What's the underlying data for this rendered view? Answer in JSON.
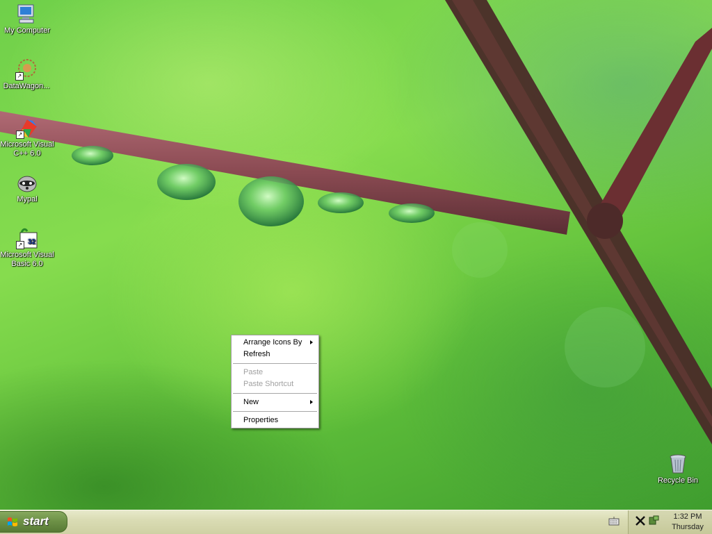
{
  "desktop": {
    "icons": [
      {
        "label": "My Computer"
      },
      {
        "label": "DataWagon..."
      },
      {
        "label": "Microsoft Visual C++ 6.0"
      },
      {
        "label": "Mypal"
      },
      {
        "label": "Microsoft Visual Basic 6.0"
      },
      {
        "label": "Recycle Bin"
      }
    ]
  },
  "context_menu": {
    "items": [
      {
        "label": "Arrange Icons By",
        "submenu": true,
        "enabled": true
      },
      {
        "label": "Refresh",
        "enabled": true
      },
      {
        "label": "Paste",
        "enabled": false
      },
      {
        "label": "Paste Shortcut",
        "enabled": false
      },
      {
        "label": "New",
        "submenu": true,
        "enabled": true
      },
      {
        "label": "Properties",
        "enabled": true
      }
    ]
  },
  "taskbar": {
    "start_label": "start",
    "clock_time": "1:32 PM",
    "clock_day": "Thursday",
    "tray_icons": [
      "keyboard-icon",
      "network-tool-icon",
      "volume-icon"
    ]
  },
  "colors": {
    "start_button": "#6e9247",
    "taskbar": "#dadcb4",
    "wallpaper_green": "#6fd04a"
  }
}
